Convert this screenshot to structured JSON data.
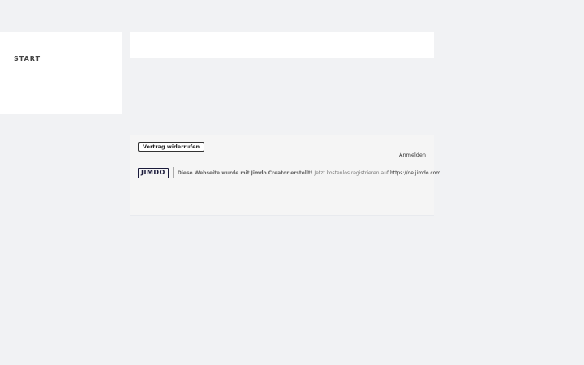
{
  "navigation": {
    "items": [
      {
        "label": "START"
      }
    ]
  },
  "footer": {
    "revoke_button_label": "Vertrag widerrufen",
    "login_label": "Anmelden",
    "jimdo": {
      "logo_text": "JIMDO",
      "created_text": "Diese Webseite wurde mit Jimdo Creator erstellt!",
      "register_text": " Jetzt kostenlos registrieren auf ",
      "url_text": "https://de.jimdo.com"
    }
  }
}
